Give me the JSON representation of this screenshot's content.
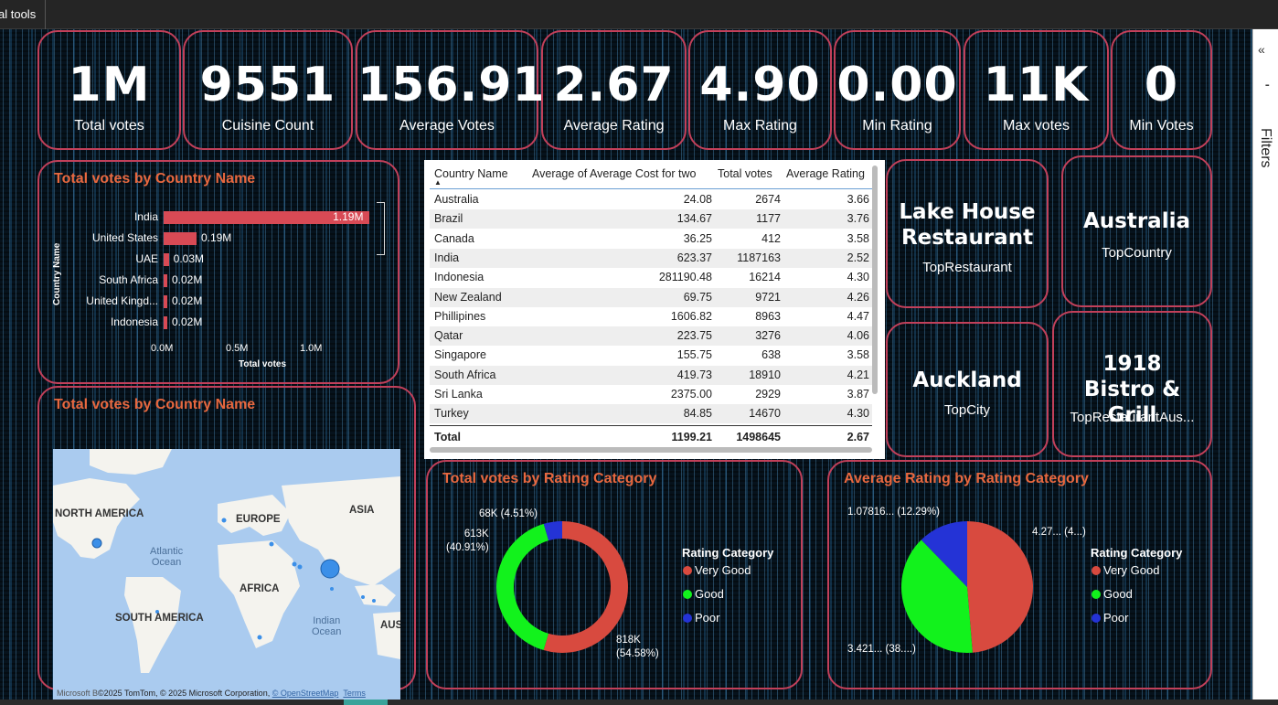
{
  "topbar": {
    "tab_label": "al tools"
  },
  "right_pane": {
    "collapse": "«",
    "filters_label": "Filters"
  },
  "kpis": [
    {
      "value": "1M",
      "label": "Total votes"
    },
    {
      "value": "9551",
      "label": "Cuisine Count"
    },
    {
      "value": "156.91",
      "label": "Average Votes"
    },
    {
      "value": "2.67",
      "label": "Average Rating"
    },
    {
      "value": "4.90",
      "label": "Max Rating"
    },
    {
      "value": "0.00",
      "label": "Min Rating"
    },
    {
      "value": "11K",
      "label": "Max votes"
    },
    {
      "value": "0",
      "label": "Min Votes"
    }
  ],
  "bar_chart": {
    "title": "Total votes by Country Name",
    "y_axis_label": "Country Name",
    "x_axis_label": "Total votes",
    "x_ticks": [
      "0.0M",
      "0.5M",
      "1.0M"
    ]
  },
  "map": {
    "title": "Total votes by Country Name",
    "continents": [
      "NORTH AMERICA",
      "EUROPE",
      "ASIA",
      "AFRICA",
      "SOUTH AMERICA",
      "AUS"
    ],
    "oceans": [
      "Atlantic\nOcean",
      "Indian\nOcean"
    ],
    "attribution_brand": "Microsoft B",
    "attribution": "©2025 TomTom, © 2025 Microsoft Corporation, ",
    "osm_link": "© OpenStreetMap",
    "terms_link": "Terms"
  },
  "table": {
    "headers": [
      "Country Name",
      "Average of Average Cost for two",
      "Total votes",
      "Average Rating"
    ],
    "rows": [
      [
        "Australia",
        "24.08",
        "2674",
        "3.66"
      ],
      [
        "Brazil",
        "134.67",
        "1177",
        "3.76"
      ],
      [
        "Canada",
        "36.25",
        "412",
        "3.58"
      ],
      [
        "India",
        "623.37",
        "1187163",
        "2.52"
      ],
      [
        "Indonesia",
        "281190.48",
        "16214",
        "4.30"
      ],
      [
        "New Zealand",
        "69.75",
        "9721",
        "4.26"
      ],
      [
        "Phillipines",
        "1606.82",
        "8963",
        "4.47"
      ],
      [
        "Qatar",
        "223.75",
        "3276",
        "4.06"
      ],
      [
        "Singapore",
        "155.75",
        "638",
        "3.58"
      ],
      [
        "South Africa",
        "419.73",
        "18910",
        "4.21"
      ],
      [
        "Sri Lanka",
        "2375.00",
        "2929",
        "3.87"
      ],
      [
        "Turkey",
        "84.85",
        "14670",
        "4.30"
      ]
    ],
    "total": [
      "Total",
      "1199.21",
      "1498645",
      "2.67"
    ]
  },
  "cards": {
    "top_restaurant": {
      "value": "Lake House Restaurant",
      "label": "TopRestaurant"
    },
    "top_country": {
      "value": "Australia",
      "label": "TopCountry"
    },
    "top_city": {
      "value": "Auckland",
      "label": "TopCity"
    },
    "top_restaurant_aus": {
      "value": "1918 Bistro & Grill",
      "label": "TopRestaurantAus..."
    }
  },
  "donut": {
    "title": "Total votes by Rating Category",
    "labels": [
      "818K\n(54.58%)",
      "613K\n(40.91%)",
      "68K (4.51%)"
    ]
  },
  "pie": {
    "title": "Average Rating by Rating Category",
    "labels": [
      "4.27... (4...)",
      "3.421... (38....)",
      "1.07816... (12.29%)"
    ]
  },
  "legend": {
    "title": "Rating Category",
    "items": [
      "Very Good",
      "Good",
      "Poor"
    ]
  },
  "colors": {
    "border": "#c2405a",
    "title": "#e8683f",
    "bar": "#d84a55",
    "very_good": "#d84a3f",
    "good": "#12f21c",
    "poor": "#2433d6"
  },
  "chart_data": [
    {
      "type": "bar",
      "title": "Total votes by Country Name",
      "xlabel": "Total votes",
      "ylabel": "Country Name",
      "categories": [
        "India",
        "United States",
        "UAE",
        "South Africa",
        "United Kingd...",
        "Indonesia"
      ],
      "values": [
        1190000,
        190000,
        30000,
        20000,
        20000,
        20000
      ],
      "value_labels": [
        "1.19M",
        "0.19M",
        "0.03M",
        "0.02M",
        "0.02M",
        "0.02M"
      ],
      "xlim": [
        0,
        1200000
      ]
    },
    {
      "type": "pie",
      "title": "Total votes by Rating Category",
      "donut": true,
      "categories": [
        "Very Good",
        "Good",
        "Poor"
      ],
      "values": [
        818000,
        613000,
        68000
      ],
      "percents": [
        54.58,
        40.91,
        4.51
      ]
    },
    {
      "type": "pie",
      "title": "Average Rating by Rating Category",
      "categories": [
        "Very Good",
        "Good",
        "Poor"
      ],
      "values": [
        4.27,
        3.421,
        1.07816
      ],
      "percents": [
        49.33,
        38.38,
        12.29
      ]
    }
  ]
}
